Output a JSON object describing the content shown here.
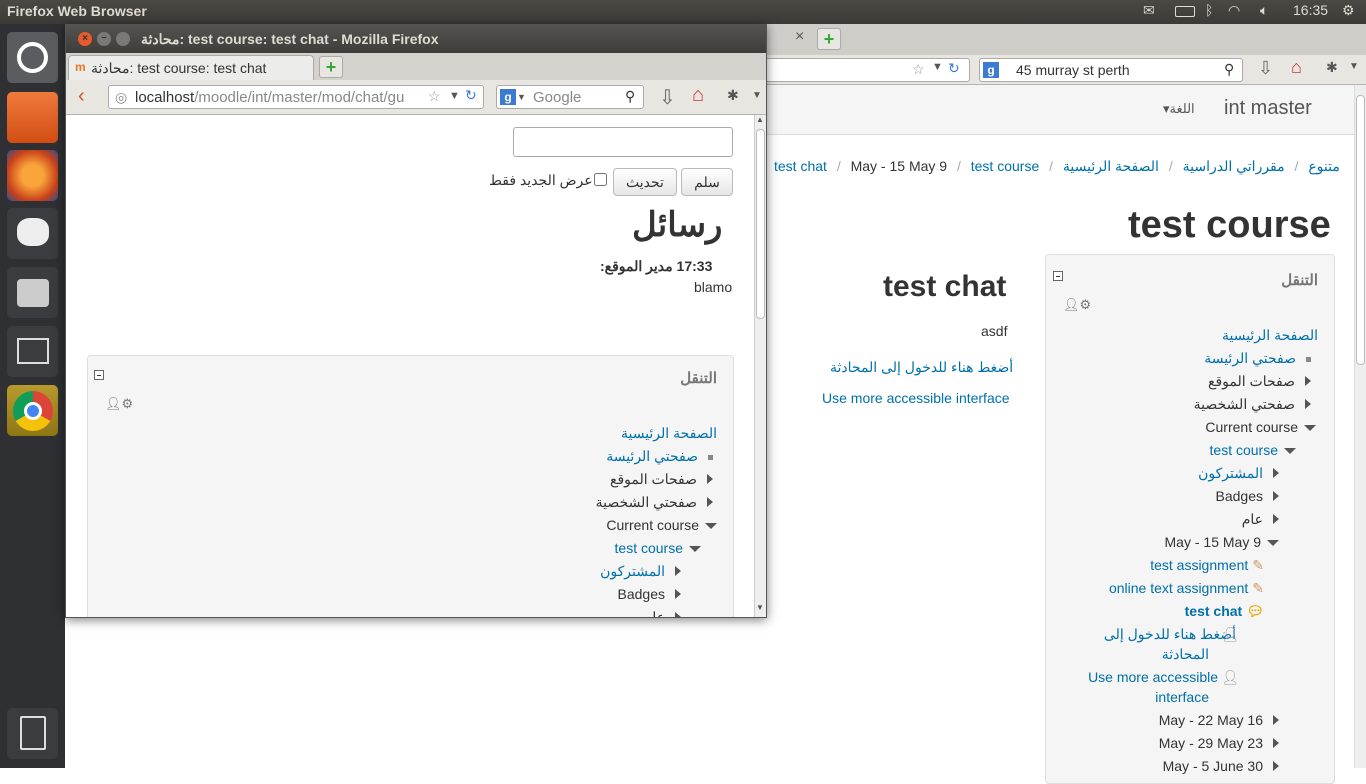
{
  "topbar": {
    "app_name": "Firefox Web Browser",
    "clock": "16:35"
  },
  "bg": {
    "tab_close": "×",
    "search_value": "45 murray st perth",
    "header_title": "int master",
    "lang_menu": "اللغة",
    "breadcrumb": [
      "الصفحة الرئيسية",
      "مقرراتي الدراسية",
      "متنوع",
      "test course",
      "May - 15 May 9",
      "test chat"
    ],
    "page_title": "test course",
    "activity_title": "test chat",
    "activity_desc": "asdf",
    "enter_link": "أضغط هناء للدخول إلى المحادثة",
    "accessible_link": "Use more accessible interface",
    "nav_block": {
      "title": "التنقل",
      "items": [
        {
          "label": "الصفحة الرئيسية"
        },
        {
          "label": "صفحتي الرئيسة"
        },
        {
          "label": "صفحات الموقع"
        },
        {
          "label": "صفحتي الشخصية"
        },
        {
          "label": "Current course"
        },
        {
          "label": "test course"
        },
        {
          "label": "المشتركون"
        },
        {
          "label": "Badges"
        },
        {
          "label": "عام"
        },
        {
          "label": "May - 15 May 9"
        },
        {
          "label": "test assignment"
        },
        {
          "label": "online text assignment"
        },
        {
          "label": "test chat"
        },
        {
          "label": "أضغط هناء للدخول إلى",
          "label2": "المحادثة"
        },
        {
          "label": "Use more accessible",
          "label2": "interface"
        },
        {
          "label": "May - 22 May 16"
        },
        {
          "label": "May - 29 May 23"
        },
        {
          "label": "May - 5 June 30"
        }
      ]
    }
  },
  "popup": {
    "window_title": "محادثة: test course: test chat - Mozilla Firefox",
    "tab_title": "محادثة: test course: test chat",
    "url_host": "localhost",
    "url_path": "/moodle/int/master/mod/chat/gu",
    "search_placeholder": "Google",
    "message_value": "",
    "send_button": "سلم",
    "refresh_button": "تحديث",
    "only_new_label": "عرض الجديد فقط",
    "messages_heading": "رسائل",
    "msg_meta": "17:33 مدير الموقع:",
    "msg_text": "blamo",
    "nav_block": {
      "title": "التنقل",
      "items": [
        {
          "label": "الصفحة الرئيسية"
        },
        {
          "label": "صفحتي الرئيسة"
        },
        {
          "label": "صفحات الموقع"
        },
        {
          "label": "صفحتي الشخصية"
        },
        {
          "label": "Current course"
        },
        {
          "label": "test course"
        },
        {
          "label": "المشتركون"
        },
        {
          "label": "Badges"
        },
        {
          "label": "عام"
        }
      ]
    }
  },
  "colors": {
    "link": "#0070a8",
    "panel": "#3b3a36",
    "launcher": "#2e3033"
  }
}
